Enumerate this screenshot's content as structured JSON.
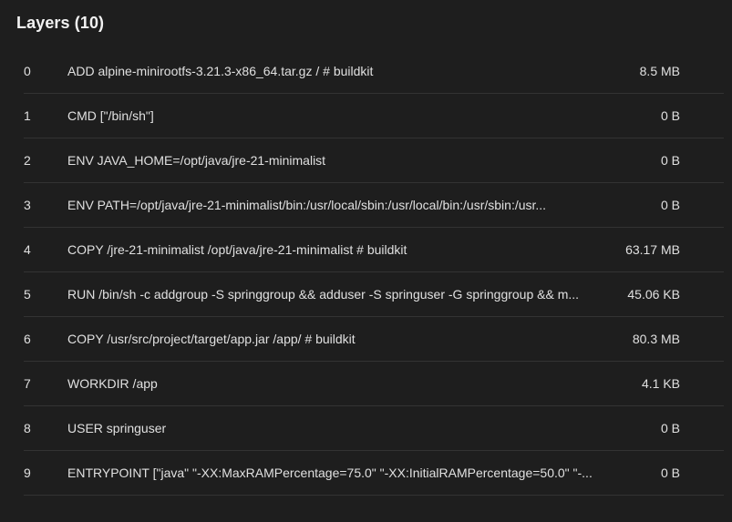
{
  "panel": {
    "title": "Layers (10)"
  },
  "layers": [
    {
      "index": "0",
      "command": "ADD alpine-minirootfs-3.21.3-x86_64.tar.gz / # buildkit",
      "size": "8.5 MB"
    },
    {
      "index": "1",
      "command": "CMD [\"/bin/sh\"]",
      "size": "0 B"
    },
    {
      "index": "2",
      "command": "ENV JAVA_HOME=/opt/java/jre-21-minimalist",
      "size": "0 B"
    },
    {
      "index": "3",
      "command": "ENV PATH=/opt/java/jre-21-minimalist/bin:/usr/local/sbin:/usr/local/bin:/usr/sbin:/usr...",
      "size": "0 B"
    },
    {
      "index": "4",
      "command": "COPY /jre-21-minimalist /opt/java/jre-21-minimalist # buildkit",
      "size": "63.17 MB"
    },
    {
      "index": "5",
      "command": "RUN /bin/sh -c addgroup -S springgroup && adduser -S springuser -G springgroup && m...",
      "size": "45.06 KB"
    },
    {
      "index": "6",
      "command": "COPY /usr/src/project/target/app.jar /app/ # buildkit",
      "size": "80.3 MB"
    },
    {
      "index": "7",
      "command": "WORKDIR /app",
      "size": "4.1 KB"
    },
    {
      "index": "8",
      "command": "USER springuser",
      "size": "0 B"
    },
    {
      "index": "9",
      "command": "ENTRYPOINT [\"java\" \"-XX:MaxRAMPercentage=75.0\" \"-XX:InitialRAMPercentage=50.0\" \"-...",
      "size": "0 B"
    }
  ],
  "colors": {
    "background": "#1e1e1e",
    "text": "#e0e0e0",
    "divider": "#333333"
  }
}
